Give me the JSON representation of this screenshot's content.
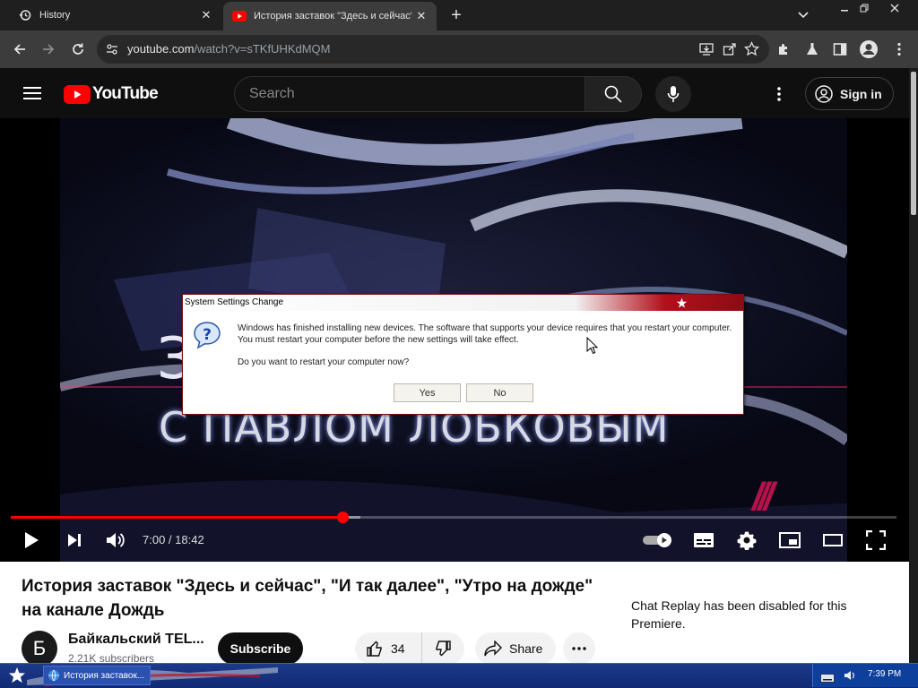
{
  "browser": {
    "tabs": [
      {
        "title": "History",
        "icon": "history-icon",
        "active": false
      },
      {
        "title": "История заставок \"Здесь и сейчас\", \"И так далее\", \"Утро на дожде\" на канале Дождь",
        "icon": "youtube-favicon",
        "active": true
      }
    ],
    "new_tab": "+",
    "url_host": "youtube.com",
    "url_path": "/watch?v=sTKfUHKdMQM"
  },
  "youtube": {
    "logo_text": "YouTube",
    "search_placeholder": "Search",
    "signin_label": "Sign in"
  },
  "video": {
    "overlay_big": "З",
    "overlay_line": "С ПАВЛОМ ЛОБКОВЫМ",
    "current_time": "7:00",
    "separator": " / ",
    "duration": "18:42",
    "progress_fraction": 0.374,
    "buffered_fraction": 0.395,
    "accent": "#ff0000"
  },
  "dialog": {
    "title": "System Settings Change",
    "message": "Windows has finished installing new devices. The software that supports your device requires that you restart your computer. You must restart your computer before the new settings will take effect.",
    "question": "Do you want to restart your computer now?",
    "yes_label": "Yes",
    "no_label": "No"
  },
  "details": {
    "title": "История заставок \"Здесь и сейчас\", \"И так далее\", \"Утро на дожде\" на канале Дождь",
    "channel_initial": "Б",
    "channel_name": "Байкальский TEL...",
    "subscribers": "2.21K subscribers",
    "subscribe_label": "Subscribe",
    "likes": "34",
    "share_label": "Share",
    "chat_replay": "Chat Replay has been disabled for this Premiere."
  },
  "taskbar": {
    "item_label": "История заставок...",
    "clock": "7:39 PM"
  }
}
